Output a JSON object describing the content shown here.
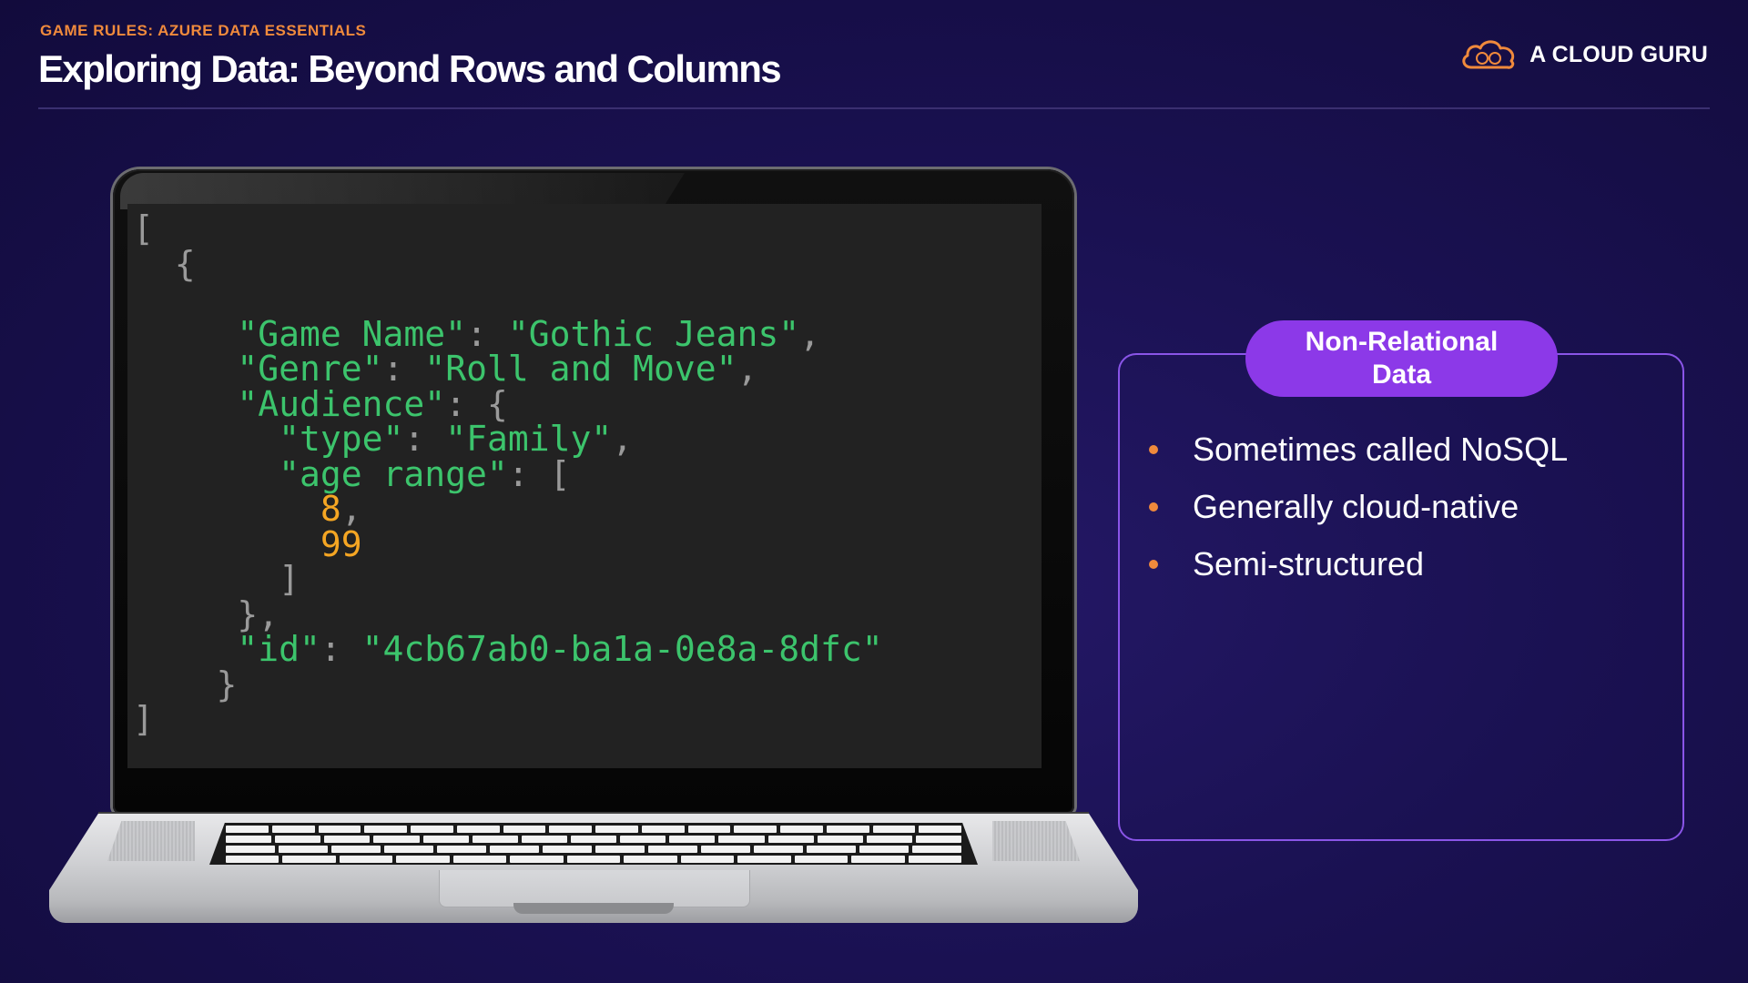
{
  "header": {
    "kicker": "GAME RULES: AZURE DATA ESSENTIALS",
    "title": "Exploring Data: Beyond Rows and Columns",
    "brand": "A CLOUD GURU"
  },
  "code": {
    "open_array": "[",
    "open_object": "{",
    "game_name_key": "\"Game Name\"",
    "game_name_value": "\"Gothic Jeans\"",
    "genre_key": "\"Genre\"",
    "genre_value": "\"Roll and Move\"",
    "audience_key": "\"Audience\"",
    "type_key": "\"type\"",
    "type_value": "\"Family\"",
    "age_range_key": "\"age range\"",
    "age_min": "8",
    "age_max": "99",
    "id_key": "\"id\"",
    "id_value": "\"4cb67ab0-ba1a-0e8a-8dfc\"",
    "close_object": "}",
    "close_array": "]"
  },
  "panel": {
    "heading": "Non-Relational Data",
    "bullets": [
      "Sometimes called NoSQL",
      "Generally cloud-native",
      "Semi-structured"
    ]
  },
  "colors": {
    "background": "#1a1152",
    "accent_orange": "#f08a3c",
    "pill_purple": "#8c39e8",
    "panel_border": "#8a55e8",
    "json_string": "#3cc46c",
    "json_number": "#f5a623"
  }
}
